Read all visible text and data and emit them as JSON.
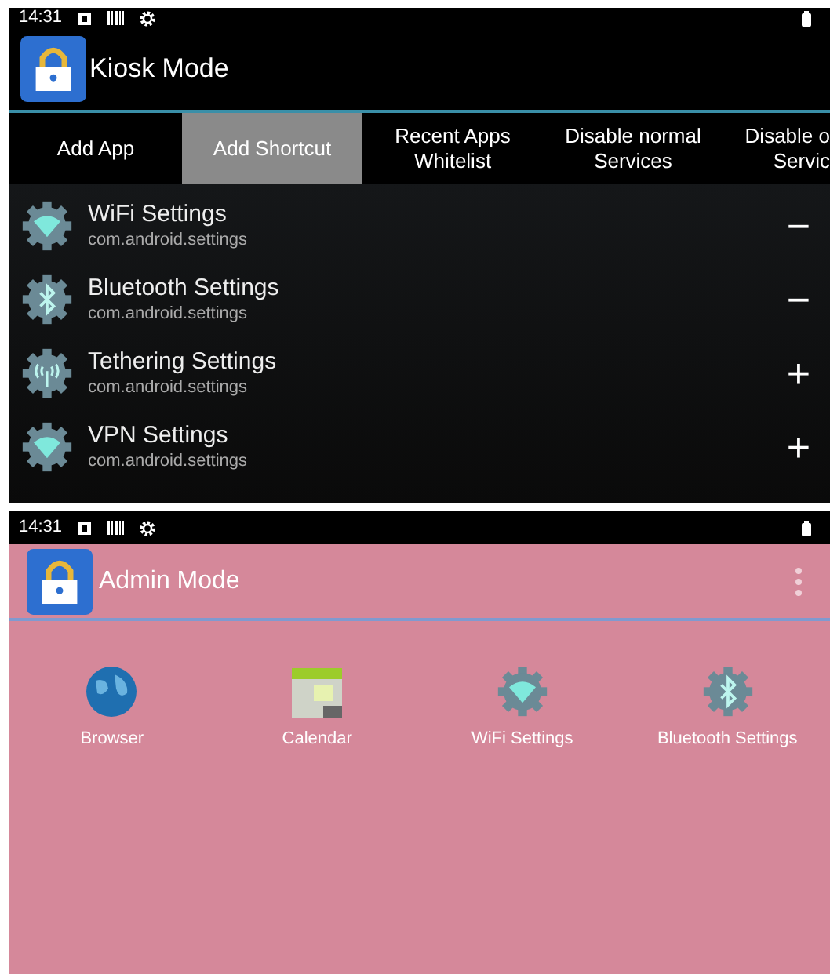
{
  "kiosk_screen": {
    "status_bar": {
      "time": "14:31"
    },
    "title": "Kiosk Mode",
    "tabs": [
      {
        "label": "Add App",
        "selected": false
      },
      {
        "label": "Add Shortcut",
        "selected": true
      },
      {
        "label": "Recent Apps\nWhitelist",
        "selected": false
      },
      {
        "label": "Disable normal\nServices",
        "selected": false
      },
      {
        "label": "Disable o\nServic",
        "selected": false
      }
    ],
    "rows": [
      {
        "kind": "wifi",
        "name": "WiFi Settings",
        "package": "com.android.settings",
        "action": "−"
      },
      {
        "kind": "bluetooth",
        "name": "Bluetooth Settings",
        "package": "com.android.settings",
        "action": "−"
      },
      {
        "kind": "tethering",
        "name": "Tethering Settings",
        "package": "com.android.settings",
        "action": "+"
      },
      {
        "kind": "wifi",
        "name": "VPN Settings",
        "package": "com.android.settings",
        "action": "+"
      }
    ]
  },
  "admin_screen": {
    "status_bar": {
      "time": "14:31"
    },
    "title": "Admin Mode",
    "shortcuts": [
      {
        "kind": "browser",
        "label": "Browser"
      },
      {
        "kind": "calendar",
        "label": "Calendar"
      },
      {
        "kind": "wifi",
        "label": "WiFi Settings"
      },
      {
        "kind": "bluetooth",
        "label": "Bluetooth Settings"
      }
    ]
  }
}
